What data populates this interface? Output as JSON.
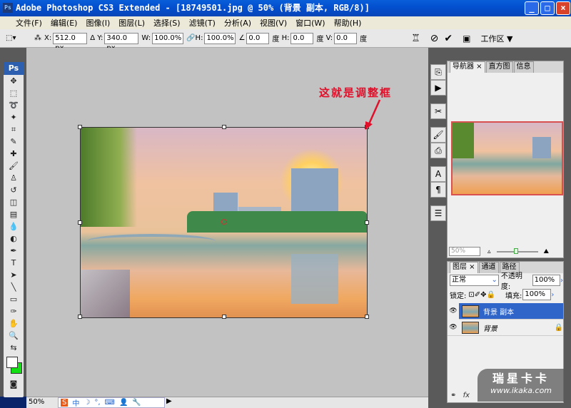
{
  "window": {
    "title": "Adobe Photoshop CS3 Extended - [18749501.jpg @ 50% (背景 副本, RGB/8)]",
    "app_icon": "Ps"
  },
  "menu": [
    "文件(F)",
    "编辑(E)",
    "图像(I)",
    "图层(L)",
    "选择(S)",
    "滤镜(T)",
    "分析(A)",
    "视图(V)",
    "窗口(W)",
    "帮助(H)"
  ],
  "options": {
    "x_label": "X:",
    "x": "512.0 px",
    "y_label": "Y:",
    "y": "340.0 px",
    "w_label": "W:",
    "w": "100.0%",
    "h_label": "H:",
    "h": "100.0%",
    "angle": "0.0",
    "deg": "度",
    "hskew_label": "H:",
    "hskew": "0.0",
    "vskew_label": "V:",
    "vskew": "0.0",
    "workspace": "工作区 ▼"
  },
  "toolbox": {
    "logo": "Ps"
  },
  "annotation": {
    "text": "这就是调整框",
    "color": "#e0102a"
  },
  "status": {
    "zoom": "50%"
  },
  "navigator": {
    "tabs": [
      "导航器 ×",
      "直方图",
      "信息"
    ],
    "zoom": "50%"
  },
  "layers": {
    "tabs": [
      "图层 ×",
      "通道",
      "路径"
    ],
    "blend_mode": "正常",
    "opacity_label": "不透明度:",
    "opacity": "100%",
    "lock_label": "锁定:",
    "fill_label": "填充:",
    "fill": "100%",
    "items": [
      {
        "name": "背景 副本",
        "selected": true
      },
      {
        "name": "背景",
        "locked": true
      }
    ]
  },
  "watermark": {
    "text": "瑞星卡卡",
    "url": "www.ikaka.com"
  },
  "ime": {
    "items": [
      "S",
      "中",
      "☽",
      "°,",
      "⌨",
      "👤",
      "🔧"
    ]
  }
}
